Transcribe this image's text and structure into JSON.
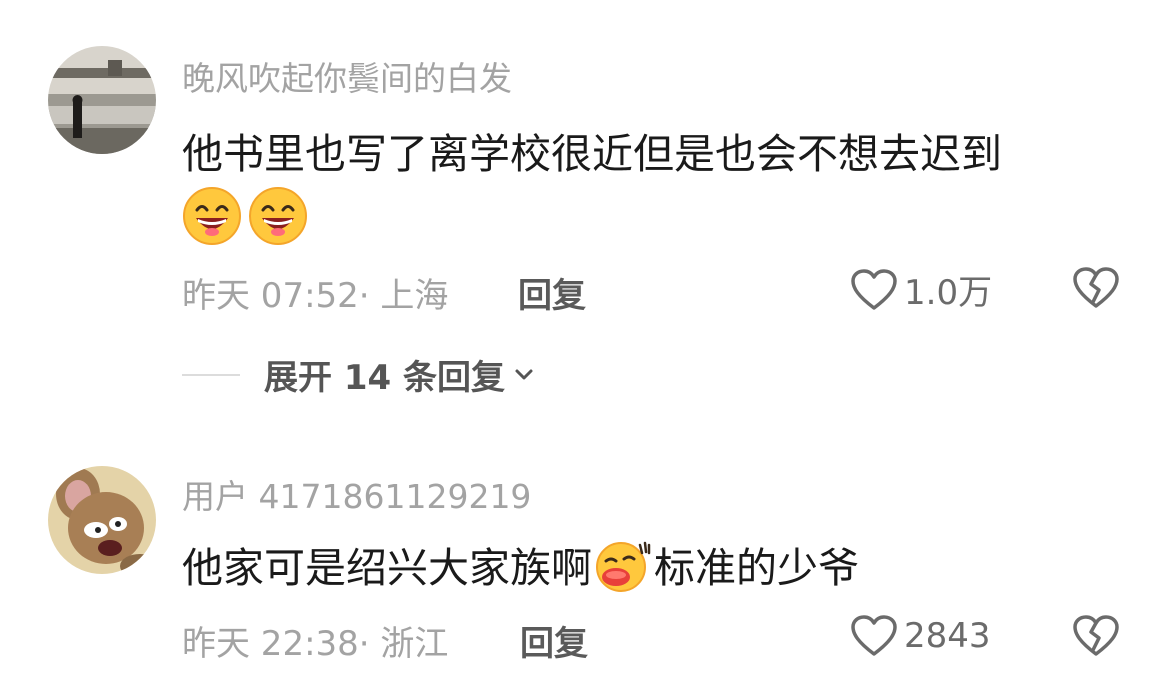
{
  "comments": [
    {
      "username": "晚风吹起你鬓间的白发",
      "text_line1": "他书里也写了离学校很近但是也会不想去迟到",
      "emojis": [
        "grinning-face-emoji",
        "grinning-face-emoji"
      ],
      "meta": "昨天 07:52· 上海",
      "reply_label": "回复",
      "likes": "1.0万",
      "expand_label": "展开 14 条回复"
    },
    {
      "username": "用户 4171861129219",
      "text_part1": "他家可是绍兴大家族啊",
      "emoji": "smug-face-emoji",
      "text_part2": "标准的少爷",
      "meta": "昨天 22:38· 浙江",
      "reply_label": "回复",
      "likes": "2843"
    }
  ],
  "colors": {
    "text": "#1a1a1a",
    "muted": "#a3a3a3",
    "emoji_face": "#ffc83d"
  }
}
